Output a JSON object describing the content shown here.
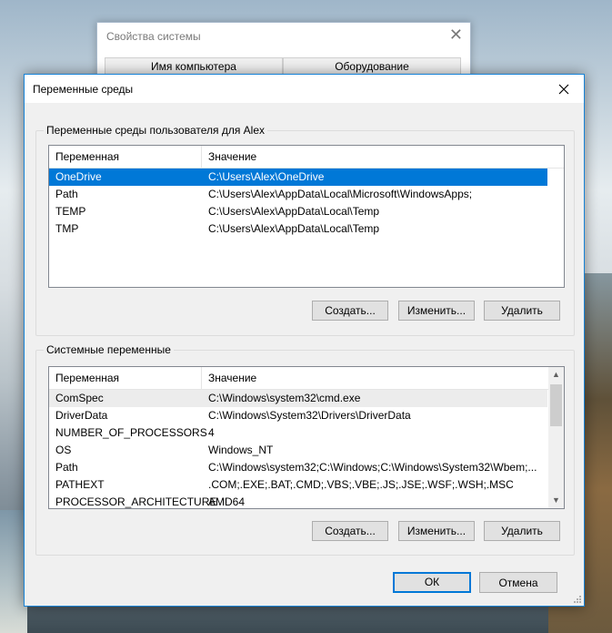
{
  "back_window": {
    "title": "Свойства системы",
    "tabs": [
      "Имя компьютера",
      "Оборудование"
    ]
  },
  "dialog": {
    "title": "Переменные среды",
    "user_group": {
      "label": "Переменные среды пользователя для Alex",
      "columns": [
        "Переменная",
        "Значение"
      ],
      "rows": [
        {
          "name": "OneDrive",
          "value": "C:\\Users\\Alex\\OneDrive"
        },
        {
          "name": "Path",
          "value": "C:\\Users\\Alex\\AppData\\Local\\Microsoft\\WindowsApps;"
        },
        {
          "name": "TEMP",
          "value": "C:\\Users\\Alex\\AppData\\Local\\Temp"
        },
        {
          "name": "TMP",
          "value": "C:\\Users\\Alex\\AppData\\Local\\Temp"
        }
      ],
      "buttons": {
        "create": "Создать...",
        "edit": "Изменить...",
        "delete": "Удалить"
      }
    },
    "system_group": {
      "label": "Системные переменные",
      "columns": [
        "Переменная",
        "Значение"
      ],
      "rows": [
        {
          "name": "ComSpec",
          "value": "C:\\Windows\\system32\\cmd.exe"
        },
        {
          "name": "DriverData",
          "value": "C:\\Windows\\System32\\Drivers\\DriverData"
        },
        {
          "name": "NUMBER_OF_PROCESSORS",
          "value": "4"
        },
        {
          "name": "OS",
          "value": "Windows_NT"
        },
        {
          "name": "Path",
          "value": "C:\\Windows\\system32;C:\\Windows;C:\\Windows\\System32\\Wbem;..."
        },
        {
          "name": "PATHEXT",
          "value": ".COM;.EXE;.BAT;.CMD;.VBS;.VBE;.JS;.JSE;.WSF;.WSH;.MSC"
        },
        {
          "name": "PROCESSOR_ARCHITECTURE",
          "value": "AMD64"
        }
      ],
      "buttons": {
        "create": "Создать...",
        "edit": "Изменить...",
        "delete": "Удалить"
      }
    },
    "ok_label": "ОК",
    "cancel_label": "Отмена"
  },
  "colors": {
    "selection": "#0078d7",
    "accent_border": "#1883d7"
  }
}
